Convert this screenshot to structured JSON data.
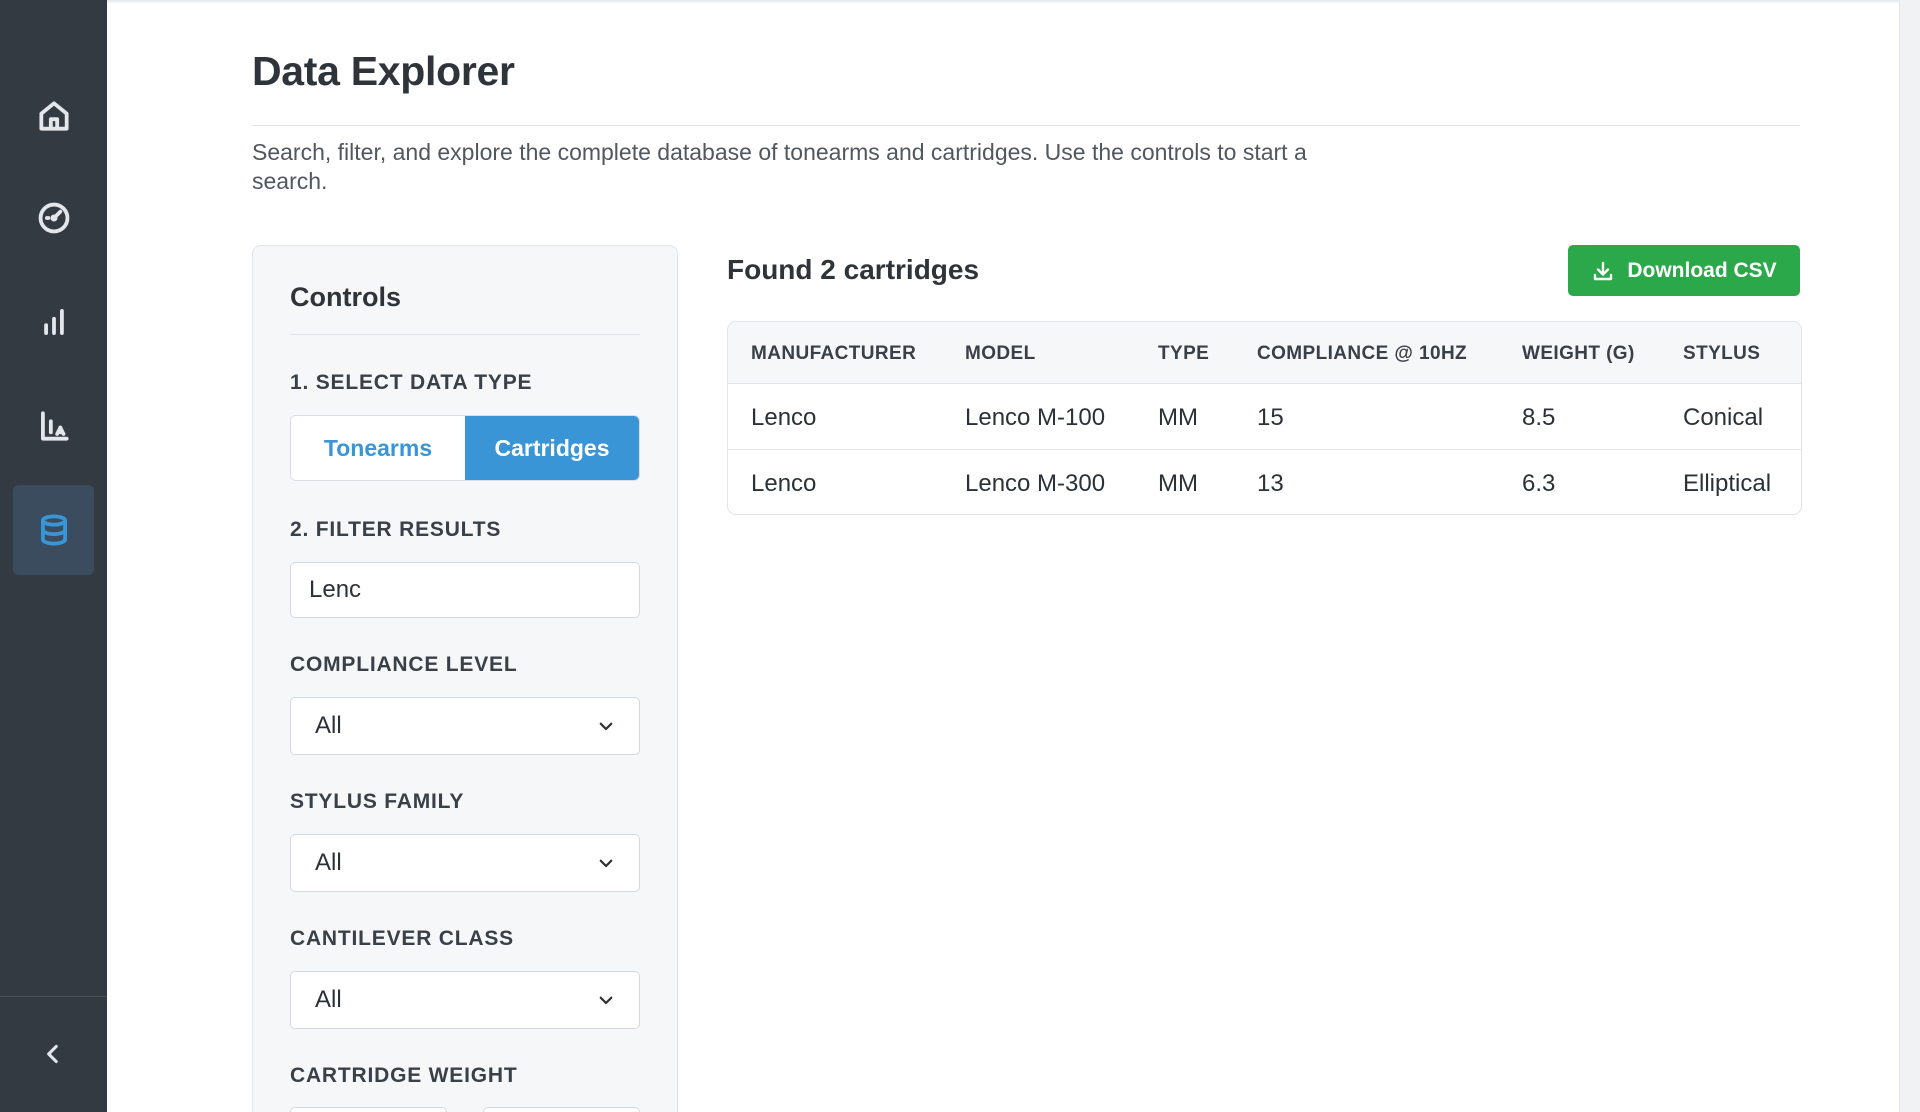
{
  "sidebar": {
    "items": [
      {
        "id": "home",
        "icon": "home-icon"
      },
      {
        "id": "gauge",
        "icon": "gauge-icon"
      },
      {
        "id": "bar-chart",
        "icon": "bar-chart-icon"
      },
      {
        "id": "chart-axes",
        "icon": "chart-axes-icon"
      },
      {
        "id": "database",
        "icon": "database-icon",
        "active": true
      }
    ],
    "collapse_icon": "chevron-left-icon"
  },
  "page": {
    "title": "Data Explorer",
    "description": "Search, filter, and explore the complete database of tonearms and cartridges. Use the controls to start a search."
  },
  "controls": {
    "title": "Controls",
    "data_type_label": "1. SELECT DATA TYPE",
    "data_type_options": [
      "Tonearms",
      "Cartridges"
    ],
    "data_type_selected": "Cartridges",
    "filter_label": "2. FILTER RESULTS",
    "filter_value": "Lenc",
    "compliance_label": "COMPLIANCE LEVEL",
    "compliance_value": "All",
    "stylus_label": "STYLUS FAMILY",
    "stylus_value": "All",
    "cantilever_label": "CANTILEVER CLASS",
    "cantilever_value": "All",
    "weight_label": "CARTRIDGE WEIGHT"
  },
  "results": {
    "title": "Found 2 cartridges",
    "download_label": "Download CSV",
    "download_icon": "download-icon",
    "columns": [
      "MANUFACTURER",
      "MODEL",
      "TYPE",
      "COMPLIANCE @ 10HZ",
      "WEIGHT (G)",
      "STYLUS"
    ],
    "rows": [
      [
        "Lenco",
        "Lenco M-100",
        "MM",
        "15",
        "8.5",
        "Conical"
      ],
      [
        "Lenco",
        "Lenco M-300",
        "MM",
        "13",
        "6.3",
        "Elliptical"
      ]
    ]
  },
  "colors": {
    "sidebar_bg": "#343a42",
    "accent": "#3a95d6",
    "download_green": "#2aa84a"
  }
}
